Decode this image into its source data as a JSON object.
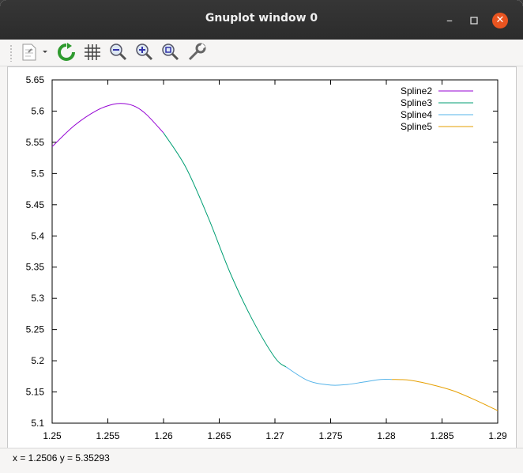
{
  "window": {
    "title": "Gnuplot window 0"
  },
  "toolbar": {
    "items": [
      {
        "name": "export-icon"
      },
      {
        "name": "replot-icon"
      },
      {
        "name": "grid-icon"
      },
      {
        "name": "zoom-out-icon"
      },
      {
        "name": "zoom-in-icon"
      },
      {
        "name": "zoom-fit-icon"
      },
      {
        "name": "settings-wrench-icon"
      }
    ]
  },
  "status": {
    "text": "x = 1.2506 y = 5.35293"
  },
  "chart_data": {
    "type": "line",
    "xlim": [
      1.25,
      1.29
    ],
    "ylim": [
      5.1,
      5.65
    ],
    "xticks": [
      "1.25",
      "1.255",
      "1.26",
      "1.265",
      "1.27",
      "1.275",
      "1.28",
      "1.285",
      "1.29"
    ],
    "yticks": [
      "5.1",
      "5.15",
      "5.2",
      "5.25",
      "5.3",
      "5.35",
      "5.4",
      "5.45",
      "5.5",
      "5.55",
      "5.6",
      "5.65"
    ],
    "legend_position": "top-right",
    "series": [
      {
        "name": "Spline2",
        "color": "#9400d3",
        "x": [
          1.25,
          1.252,
          1.254,
          1.2555,
          1.2565,
          1.2575,
          1.2585,
          1.26
        ],
        "y": [
          5.543,
          5.577,
          5.601,
          5.611,
          5.612,
          5.607,
          5.594,
          5.565
        ]
      },
      {
        "name": "Spline3",
        "color": "#009e73",
        "x": [
          1.26,
          1.262,
          1.264,
          1.266,
          1.268,
          1.27,
          1.271
        ],
        "y": [
          5.565,
          5.51,
          5.43,
          5.34,
          5.265,
          5.205,
          5.19
        ]
      },
      {
        "name": "Spline4",
        "color": "#56b4e9",
        "x": [
          1.271,
          1.273,
          1.275,
          1.2765,
          1.278,
          1.2795,
          1.2805
        ],
        "y": [
          5.19,
          5.168,
          5.161,
          5.162,
          5.166,
          5.17,
          5.17
        ]
      },
      {
        "name": "Spline5",
        "color": "#e69f00",
        "x": [
          1.2805,
          1.282,
          1.284,
          1.286,
          1.288,
          1.29
        ],
        "y": [
          5.17,
          5.169,
          5.162,
          5.152,
          5.137,
          5.12
        ]
      }
    ]
  }
}
